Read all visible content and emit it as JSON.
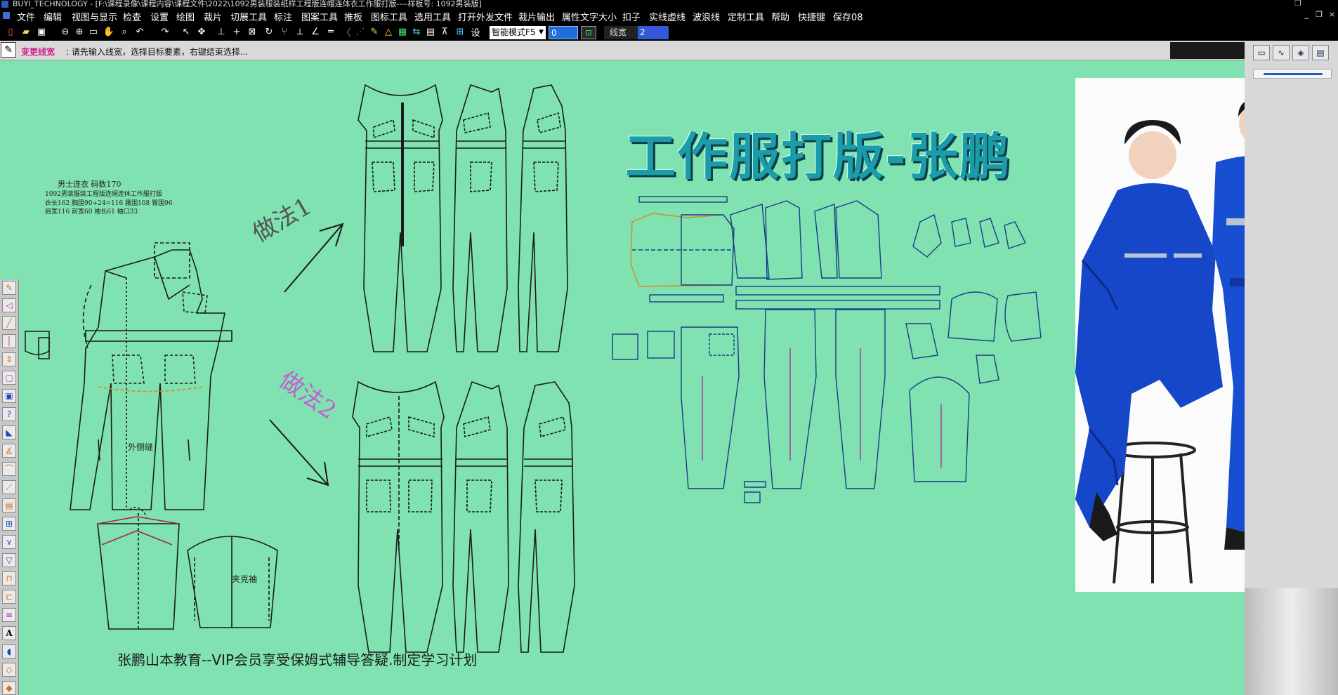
{
  "window": {
    "title": "BUYI_TECHNOLOGY - [F:\\课程录像\\课程内容\\课程文件\\2022\\1092男装服装纸样工程版连帽连体衣工作服打版----样板号: 1092男装版]"
  },
  "menu": {
    "items": [
      "文件",
      "编辑",
      "视图与显示",
      "检查",
      "设置",
      "绘图",
      "裁片",
      "切展工具",
      "标注",
      "图案工具",
      "推板",
      "图标工具",
      "选用工具",
      "打开外发文件",
      "裁片输出",
      "属性文字大小",
      "扣子",
      "实线虚线",
      "波浪线",
      "定制工具",
      "帮助",
      "快捷键",
      "保存08"
    ]
  },
  "toolbar": {
    "mode_select": "智能模式F5",
    "number_value": "0",
    "linewidth_label": "线宽",
    "linewidth_value": "2"
  },
  "status": {
    "label": "变更线宽",
    "message": ": 请先输入线宽，选择目标要素，右键结束选择..."
  },
  "canvas": {
    "headline": "工作服打版-张鹏",
    "footer": "张鹏山本教育--VIP会员享受保姆式辅导答疑.制定学习计划",
    "method1_label": "做法1",
    "method2_label": "做法2",
    "draft_notes": {
      "style": "男士连衣    码数170",
      "spec": "1092男装服装工程版连帽连体工作服打版",
      "measure1": "衣长162  胸围90+24=116  腰围108 臀围96",
      "measure2": "肩宽116  前宽60  袖长61  袖口33",
      "outer_seam": "外侧缝",
      "sleeve": "夹克袖"
    }
  },
  "colors": {
    "canvas_bg": "#7fe2b0",
    "headline": "#1a9da8",
    "status_label": "#d0208c",
    "accent_blue": "#1e6fd9"
  }
}
